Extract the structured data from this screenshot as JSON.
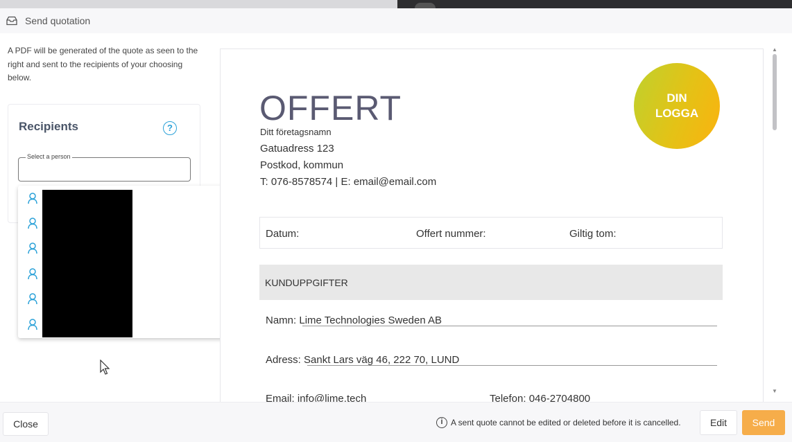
{
  "dialog": {
    "title": "Send quotation",
    "title_icon": "inbox-icon"
  },
  "sidebar": {
    "description": "A PDF will be generated of the quote as seen to the right and sent to the recipients of your choosing below.",
    "recipients": {
      "title": "Recipients",
      "help_icon": "help-icon",
      "help_glyph": "?",
      "select_label": "Select a person",
      "select_value": ""
    },
    "dropdown": {
      "items": [
        {
          "icon": "person-icon"
        },
        {
          "icon": "person-icon"
        },
        {
          "icon": "person-icon"
        },
        {
          "icon": "person-icon"
        },
        {
          "icon": "person-icon"
        },
        {
          "icon": "person-icon"
        }
      ]
    }
  },
  "preview": {
    "heading": "OFFERT",
    "company_name": "Ditt företagsnamn",
    "street": "Gatuadress 123",
    "postal": "Postkod, kommun",
    "contact": "T: 076-8578574 | E: email@email.com",
    "logo_line1": "DIN",
    "logo_line2": "LOGGA",
    "date_label": "Datum:",
    "offer_number_label": "Offert nummer:",
    "valid_until_label": "Giltig tom:",
    "section_title": "KUNDUPPGIFTER",
    "name_label": "Namn:",
    "name_value": "Lime Technologies Sweden AB",
    "address_label": "Adress:",
    "address_value": "Sankt Lars väg 46, 222 70, LUND",
    "email_label": "Email:",
    "email_value": "info@lime.tech",
    "phone_label": "Telefon:",
    "phone_value": "046-2704800"
  },
  "footer": {
    "close_label": "Close",
    "info_glyph": "i",
    "info_text": "A sent quote cannot be edited or deleted before it is cancelled.",
    "edit_label": "Edit",
    "send_label": "Send"
  },
  "colors": {
    "accent_blue": "#2aa1d8",
    "send_button": "#f6ad4a",
    "logo_start": "#bfd12d",
    "logo_end": "#fbb20f"
  }
}
